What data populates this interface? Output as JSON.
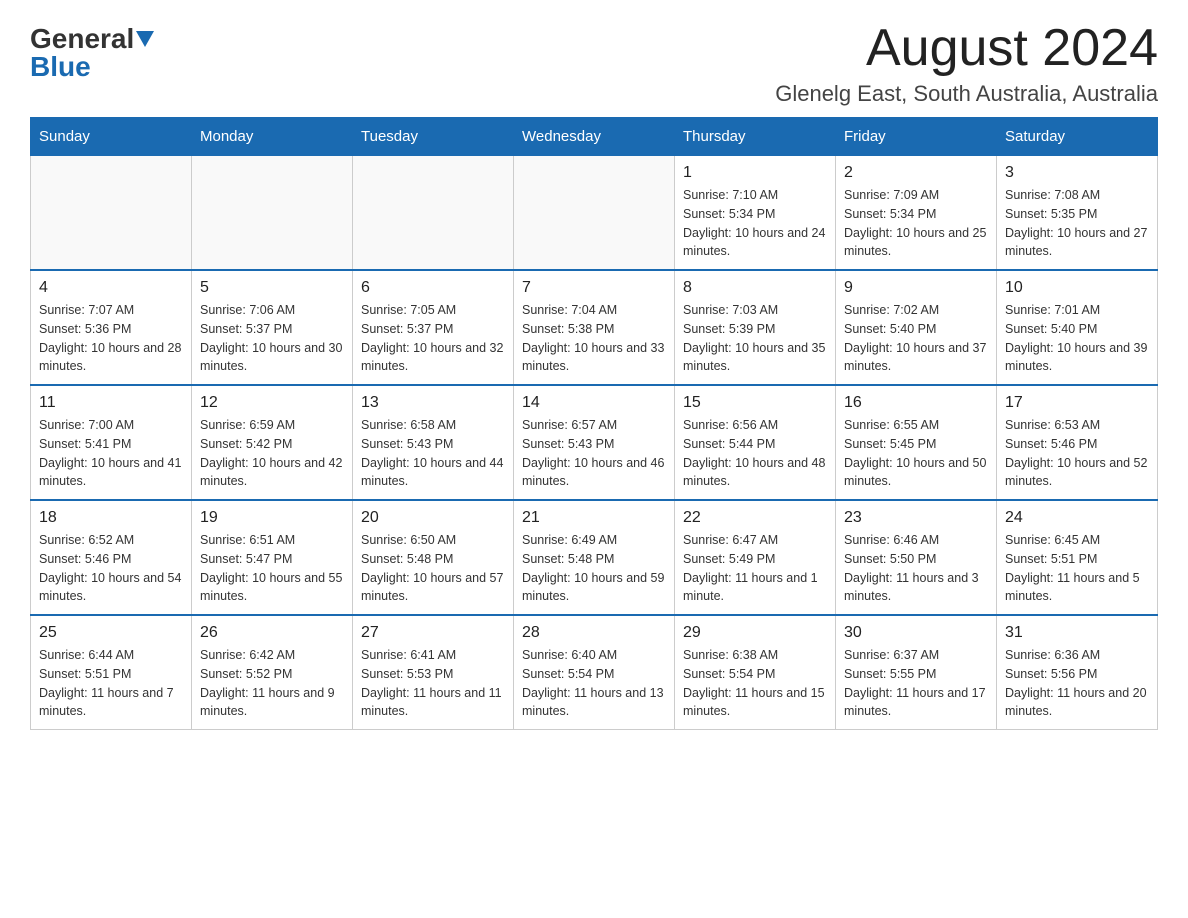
{
  "header": {
    "logo_general": "General",
    "logo_blue": "Blue",
    "month_title": "August 2024",
    "location": "Glenelg East, South Australia, Australia"
  },
  "days_of_week": [
    "Sunday",
    "Monday",
    "Tuesday",
    "Wednesday",
    "Thursday",
    "Friday",
    "Saturday"
  ],
  "weeks": [
    [
      {
        "day": "",
        "info": ""
      },
      {
        "day": "",
        "info": ""
      },
      {
        "day": "",
        "info": ""
      },
      {
        "day": "",
        "info": ""
      },
      {
        "day": "1",
        "info": "Sunrise: 7:10 AM\nSunset: 5:34 PM\nDaylight: 10 hours and 24 minutes."
      },
      {
        "day": "2",
        "info": "Sunrise: 7:09 AM\nSunset: 5:34 PM\nDaylight: 10 hours and 25 minutes."
      },
      {
        "day": "3",
        "info": "Sunrise: 7:08 AM\nSunset: 5:35 PM\nDaylight: 10 hours and 27 minutes."
      }
    ],
    [
      {
        "day": "4",
        "info": "Sunrise: 7:07 AM\nSunset: 5:36 PM\nDaylight: 10 hours and 28 minutes."
      },
      {
        "day": "5",
        "info": "Sunrise: 7:06 AM\nSunset: 5:37 PM\nDaylight: 10 hours and 30 minutes."
      },
      {
        "day": "6",
        "info": "Sunrise: 7:05 AM\nSunset: 5:37 PM\nDaylight: 10 hours and 32 minutes."
      },
      {
        "day": "7",
        "info": "Sunrise: 7:04 AM\nSunset: 5:38 PM\nDaylight: 10 hours and 33 minutes."
      },
      {
        "day": "8",
        "info": "Sunrise: 7:03 AM\nSunset: 5:39 PM\nDaylight: 10 hours and 35 minutes."
      },
      {
        "day": "9",
        "info": "Sunrise: 7:02 AM\nSunset: 5:40 PM\nDaylight: 10 hours and 37 minutes."
      },
      {
        "day": "10",
        "info": "Sunrise: 7:01 AM\nSunset: 5:40 PM\nDaylight: 10 hours and 39 minutes."
      }
    ],
    [
      {
        "day": "11",
        "info": "Sunrise: 7:00 AM\nSunset: 5:41 PM\nDaylight: 10 hours and 41 minutes."
      },
      {
        "day": "12",
        "info": "Sunrise: 6:59 AM\nSunset: 5:42 PM\nDaylight: 10 hours and 42 minutes."
      },
      {
        "day": "13",
        "info": "Sunrise: 6:58 AM\nSunset: 5:43 PM\nDaylight: 10 hours and 44 minutes."
      },
      {
        "day": "14",
        "info": "Sunrise: 6:57 AM\nSunset: 5:43 PM\nDaylight: 10 hours and 46 minutes."
      },
      {
        "day": "15",
        "info": "Sunrise: 6:56 AM\nSunset: 5:44 PM\nDaylight: 10 hours and 48 minutes."
      },
      {
        "day": "16",
        "info": "Sunrise: 6:55 AM\nSunset: 5:45 PM\nDaylight: 10 hours and 50 minutes."
      },
      {
        "day": "17",
        "info": "Sunrise: 6:53 AM\nSunset: 5:46 PM\nDaylight: 10 hours and 52 minutes."
      }
    ],
    [
      {
        "day": "18",
        "info": "Sunrise: 6:52 AM\nSunset: 5:46 PM\nDaylight: 10 hours and 54 minutes."
      },
      {
        "day": "19",
        "info": "Sunrise: 6:51 AM\nSunset: 5:47 PM\nDaylight: 10 hours and 55 minutes."
      },
      {
        "day": "20",
        "info": "Sunrise: 6:50 AM\nSunset: 5:48 PM\nDaylight: 10 hours and 57 minutes."
      },
      {
        "day": "21",
        "info": "Sunrise: 6:49 AM\nSunset: 5:48 PM\nDaylight: 10 hours and 59 minutes."
      },
      {
        "day": "22",
        "info": "Sunrise: 6:47 AM\nSunset: 5:49 PM\nDaylight: 11 hours and 1 minute."
      },
      {
        "day": "23",
        "info": "Sunrise: 6:46 AM\nSunset: 5:50 PM\nDaylight: 11 hours and 3 minutes."
      },
      {
        "day": "24",
        "info": "Sunrise: 6:45 AM\nSunset: 5:51 PM\nDaylight: 11 hours and 5 minutes."
      }
    ],
    [
      {
        "day": "25",
        "info": "Sunrise: 6:44 AM\nSunset: 5:51 PM\nDaylight: 11 hours and 7 minutes."
      },
      {
        "day": "26",
        "info": "Sunrise: 6:42 AM\nSunset: 5:52 PM\nDaylight: 11 hours and 9 minutes."
      },
      {
        "day": "27",
        "info": "Sunrise: 6:41 AM\nSunset: 5:53 PM\nDaylight: 11 hours and 11 minutes."
      },
      {
        "day": "28",
        "info": "Sunrise: 6:40 AM\nSunset: 5:54 PM\nDaylight: 11 hours and 13 minutes."
      },
      {
        "day": "29",
        "info": "Sunrise: 6:38 AM\nSunset: 5:54 PM\nDaylight: 11 hours and 15 minutes."
      },
      {
        "day": "30",
        "info": "Sunrise: 6:37 AM\nSunset: 5:55 PM\nDaylight: 11 hours and 17 minutes."
      },
      {
        "day": "31",
        "info": "Sunrise: 6:36 AM\nSunset: 5:56 PM\nDaylight: 11 hours and 20 minutes."
      }
    ]
  ]
}
